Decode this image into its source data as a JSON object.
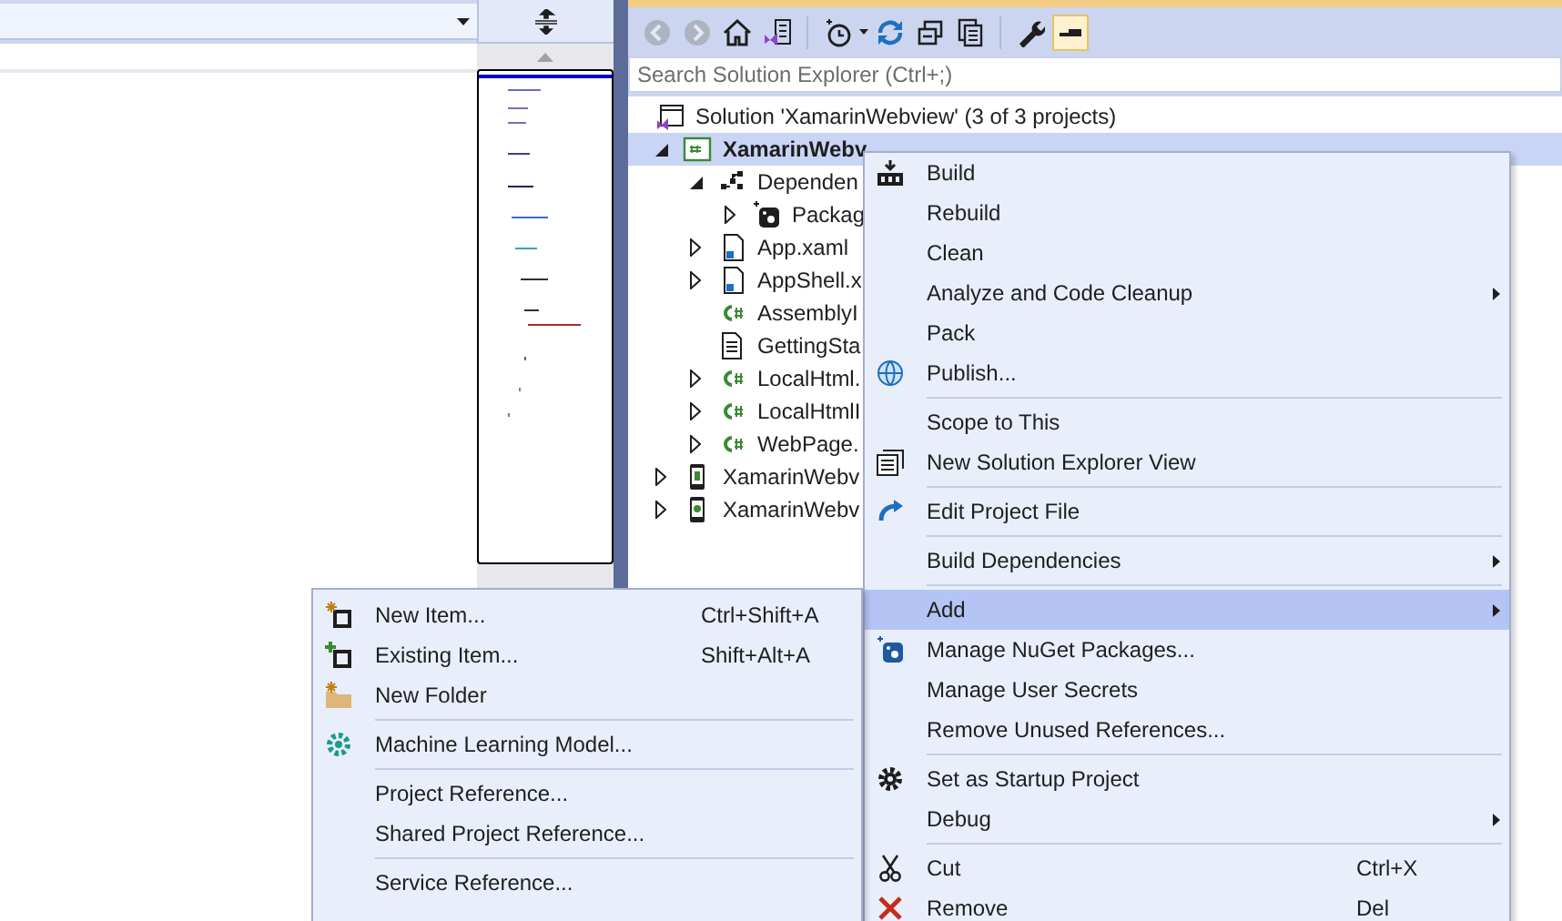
{
  "editor": {
    "navigation_dropdown": {
      "selected": false
    }
  },
  "solution_explorer": {
    "toolbar": [
      {
        "disabled": true
      },
      {
        "disabled": true
      },
      {
        "disabled": false
      },
      {
        "disabled": false
      },
      {
        "disabled": false
      },
      {
        "disabled": false
      },
      {
        "disabled": false
      },
      {
        "disabled": false
      },
      {
        "disabled": false
      },
      {
        "disabled": false,
        "on": true
      }
    ],
    "search": {
      "placeholder": "Search Solution Explorer (Ctrl+;)"
    },
    "tree": {
      "solution": {
        "label": "Solution 'XamarinWebview' (3 of 3 projects)",
        "selected": false
      },
      "items": [
        {
          "label": "XamarinWebv",
          "kind": "project",
          "selected": true,
          "expanded": true,
          "children": [
            {
              "label": "Dependen",
              "kind": "dependencies",
              "selected": false,
              "expanded": true,
              "children": [
                {
                  "label": "Packag",
                  "kind": "packages",
                  "selected": false,
                  "expanded": false
                }
              ]
            },
            {
              "label": "App.xaml",
              "kind": "xaml",
              "selected": false,
              "expanded": false
            },
            {
              "label": "AppShell.x",
              "kind": "xaml",
              "selected": false,
              "expanded": false
            },
            {
              "label": "AssemblyI",
              "kind": "cs",
              "selected": false
            },
            {
              "label": "GettingSta",
              "kind": "text",
              "selected": false
            },
            {
              "label": "LocalHtml.",
              "kind": "cs",
              "selected": false,
              "expanded": false
            },
            {
              "label": "LocalHtmlI",
              "kind": "cs",
              "selected": false,
              "expanded": false
            },
            {
              "label": "WebPage.",
              "kind": "cs",
              "selected": false,
              "expanded": false
            }
          ]
        },
        {
          "label": "XamarinWebv",
          "kind": "android",
          "selected": false,
          "expanded": false
        },
        {
          "label": "XamarinWebv",
          "kind": "ios",
          "selected": false,
          "expanded": false
        }
      ]
    }
  },
  "context_menu": {
    "items": [
      {
        "kind": "item",
        "label": "Build",
        "submenu": false,
        "selected": false
      },
      {
        "kind": "item",
        "label": "Rebuild",
        "submenu": false,
        "selected": false
      },
      {
        "kind": "item",
        "label": "Clean",
        "submenu": false,
        "selected": false
      },
      {
        "kind": "item",
        "label": "Analyze and Code Cleanup",
        "submenu": true,
        "selected": false
      },
      {
        "kind": "item",
        "label": "Pack",
        "submenu": false,
        "selected": false
      },
      {
        "kind": "item",
        "label": "Publish...",
        "submenu": false,
        "selected": false
      },
      {
        "kind": "separator"
      },
      {
        "kind": "item",
        "label": "Scope to This",
        "submenu": false,
        "selected": false
      },
      {
        "kind": "item",
        "label": "New Solution Explorer View",
        "submenu": false,
        "selected": false
      },
      {
        "kind": "separator"
      },
      {
        "kind": "item",
        "label": "Edit Project File",
        "submenu": false,
        "selected": false
      },
      {
        "kind": "separator"
      },
      {
        "kind": "item",
        "label": "Build Dependencies",
        "submenu": true,
        "selected": false
      },
      {
        "kind": "separator"
      },
      {
        "kind": "item",
        "label": "Add",
        "submenu": true,
        "selected": true
      },
      {
        "kind": "item",
        "label": "Manage NuGet Packages...",
        "submenu": false,
        "selected": false
      },
      {
        "kind": "item",
        "label": "Manage User Secrets",
        "submenu": false,
        "selected": false
      },
      {
        "kind": "item",
        "label": "Remove Unused References...",
        "submenu": false,
        "selected": false
      },
      {
        "kind": "separator"
      },
      {
        "kind": "item",
        "label": "Set as Startup Project",
        "submenu": false,
        "selected": false
      },
      {
        "kind": "item",
        "label": "Debug",
        "submenu": true,
        "selected": false
      },
      {
        "kind": "separator"
      },
      {
        "kind": "item",
        "label": "Cut",
        "shortcut": "Ctrl+X",
        "submenu": false,
        "selected": false
      },
      {
        "kind": "item",
        "label": "Remove",
        "shortcut": "Del",
        "submenu": false,
        "selected": false
      }
    ]
  },
  "add_submenu": {
    "items": [
      {
        "kind": "item",
        "label": "New Item...",
        "shortcut": "Ctrl+Shift+A",
        "selected": false
      },
      {
        "kind": "item",
        "label": "Existing Item...",
        "shortcut": "Shift+Alt+A",
        "selected": false
      },
      {
        "kind": "item",
        "label": "New Folder",
        "selected": false
      },
      {
        "kind": "separator"
      },
      {
        "kind": "item",
        "label": "Machine Learning Model...",
        "selected": false
      },
      {
        "kind": "separator"
      },
      {
        "kind": "item",
        "label": "Project Reference...",
        "selected": false
      },
      {
        "kind": "item",
        "label": "Shared Project Reference...",
        "selected": false
      },
      {
        "kind": "separator"
      },
      {
        "kind": "item",
        "label": "Service Reference...",
        "selected": false
      }
    ]
  }
}
